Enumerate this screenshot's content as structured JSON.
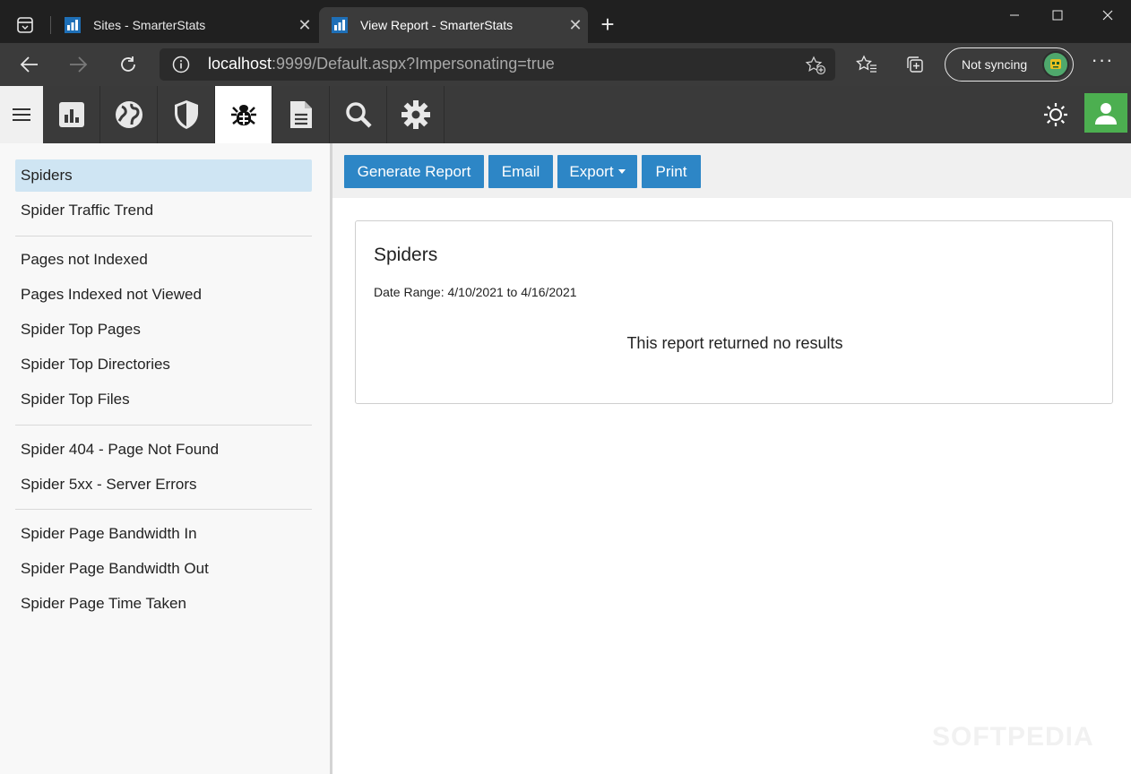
{
  "browser": {
    "tabs": [
      {
        "title": "Sites - SmarterStats",
        "icon": "smarterstats-favicon",
        "active": false
      },
      {
        "title": "View Report - SmarterStats",
        "icon": "smarterstats-favicon",
        "active": true
      }
    ],
    "address": {
      "host": "localhost",
      "rest": ":9999/Default.aspx?Impersonating=true"
    },
    "sync_label": "Not syncing",
    "more_label": "···",
    "new_tab_label": "+",
    "tab_close_label": "✕"
  },
  "app_nav": {
    "icons": [
      "bar-chart-icon",
      "globe-icon",
      "shield-icon",
      "bug-icon",
      "document-icon",
      "search-icon",
      "gear-icon"
    ],
    "active": "bug-icon"
  },
  "sidebar": {
    "items": [
      "Spiders",
      "Spider Traffic Trend",
      "Pages not Indexed",
      "Pages Indexed not Viewed",
      "Spider Top Pages",
      "Spider Top Directories",
      "Spider Top Files",
      "Spider 404 - Page Not Found",
      "Spider 5xx - Server Errors",
      "Spider Page Bandwidth In",
      "Spider Page Bandwidth Out",
      "Spider Page Time Taken"
    ],
    "selected": "Spiders"
  },
  "actions": {
    "generate": "Generate Report",
    "email": "Email",
    "export": "Export",
    "print": "Print"
  },
  "report": {
    "title": "Spiders",
    "date_range": "Date Range: 4/10/2021 to 4/16/2021",
    "empty_message": "This report returned no results"
  },
  "watermark": "SOFTPEDIA",
  "colors": {
    "accent": "#2d86c6",
    "selected_item": "#cfe5f3",
    "user_button": "#4caf50"
  }
}
